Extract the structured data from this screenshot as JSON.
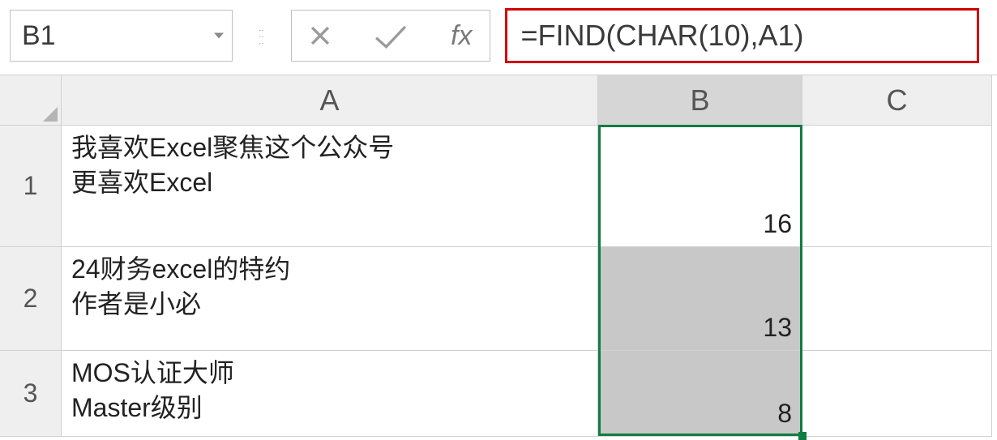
{
  "nameBox": "B1",
  "formula": "=FIND(CHAR(10),A1)",
  "fxLabel": "fx",
  "columns": [
    "A",
    "B",
    "C"
  ],
  "rows": [
    "1",
    "2",
    "3"
  ],
  "cells": {
    "A1": "我喜欢Excel聚焦这个公众号\n更喜欢Excel",
    "A2": "24财务excel的特约\n作者是小必",
    "A3": "MOS认证大师\nMaster级别",
    "B1": "16",
    "B2": "13",
    "B3": "8"
  },
  "selection": {
    "active": "B1",
    "range": "B1:B3"
  }
}
